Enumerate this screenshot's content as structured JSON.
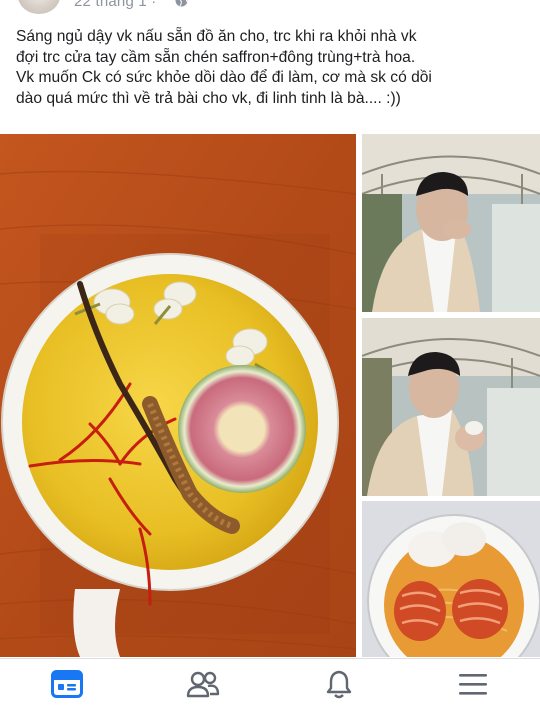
{
  "post": {
    "timestamp": "22 tháng 1 · ",
    "privacy_icon": "globe-icon",
    "caption_lines": [
      "Sáng ngủ dậy vk nấu sẵn đồ ăn cho, trc khi ra khỏi nhà vk",
      "đợi trc cửa tay cầm sẵn chén saffron+đông trùng+trà hoa.",
      "Vk muốn Ck có sức khỏe dồi dào để đi làm, cơ mà sk có dồi",
      "dào quá mức thì về trả bài cho vk, đi linh tinh là bà.... :))"
    ],
    "photos": [
      {
        "subject": "cup-of-saffron-cordyceps-flower-tea"
      },
      {
        "subject": "man-in-beige-suit-drinking"
      },
      {
        "subject": "man-in-beige-suit-holding-cup"
      },
      {
        "subject": "bowl-of-noodles-with-prawns"
      }
    ]
  },
  "bottom_nav": [
    {
      "icon": "news-feed-icon",
      "active": true
    },
    {
      "icon": "friends-icon",
      "active": false
    },
    {
      "icon": "notifications-bell-icon",
      "active": false
    },
    {
      "icon": "menu-hamburger-icon",
      "active": false
    }
  ],
  "colors": {
    "accent": "#1877f2",
    "text": "#1c1e21",
    "secondary_text": "#8d949e",
    "inactive_icon": "#606770"
  }
}
